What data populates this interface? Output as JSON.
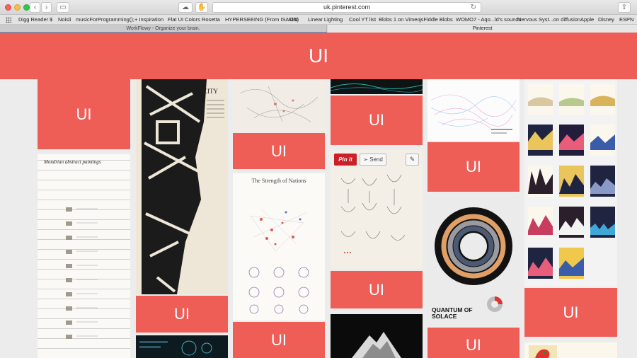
{
  "browser": {
    "url": "uk.pinterest.com",
    "bookmarks": [
      "Digg Reader",
      "$",
      "Noisli",
      "musicForProgramming();",
      "+ Inspiration",
      "Flat UI Colors",
      "Rosetta",
      "HYPERSEEING (From ISAMA)",
      "Old",
      "Linear Lighting",
      "Cool YT list",
      "Blobs 1 on Vimeo",
      "jsFiddle Blobs",
      "WOMO7 - Aqo...ld's sounds",
      "Nervous Syst...on diffusion",
      "Apple",
      "Disney",
      "ESPN"
    ],
    "tabs": [
      "WorkFlowy - Organize your brain.",
      "Pinterest"
    ]
  },
  "banner": {
    "label": "UI"
  },
  "blocks": {
    "label": "UI"
  },
  "pins": {
    "mondrian_title": "Mondrian abstract paintings",
    "nations_title": "The Strength of Nations",
    "quantum_title": "QUANTUM OF SOLACE",
    "pin_it": "Pin it",
    "send": "Send"
  },
  "colors": {
    "accent": "#ef5d57",
    "pinterest_red": "#cb2027"
  },
  "icons": [
    "back-icon",
    "forward-icon",
    "sidebar-icon",
    "cloud-icon",
    "share-icon",
    "reload-icon",
    "grid-icon",
    "edit-icon",
    "send-icon"
  ]
}
